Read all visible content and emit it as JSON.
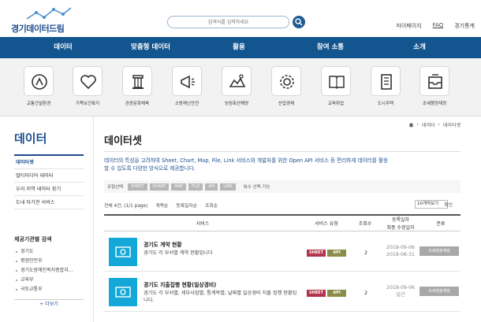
{
  "header": {
    "logo_text": "경기데이터드림",
    "search_placeholder": "검색어를 입력하세요",
    "top_links": [
      "마이페이지",
      "FAQ",
      "경기통계"
    ]
  },
  "nav": [
    "데이터",
    "맞춤형 데이터",
    "활용",
    "참여 소통",
    "소개"
  ],
  "categories": [
    {
      "label": "교통건설환경",
      "icon": "road-sign-icon"
    },
    {
      "label": "가족보건복지",
      "icon": "heart-icon"
    },
    {
      "label": "관광문화체육",
      "icon": "pillar-icon"
    },
    {
      "label": "소방재난안전",
      "icon": "megaphone-icon"
    },
    {
      "label": "농림축산해양",
      "icon": "farm-icon"
    },
    {
      "label": "산업경제",
      "icon": "gear-icon"
    },
    {
      "label": "교육취업",
      "icon": "book-icon"
    },
    {
      "label": "도시주택",
      "icon": "building-icon"
    },
    {
      "label": "조세행정재정",
      "icon": "inbox-icon"
    }
  ],
  "sidebar": {
    "title": "데이터",
    "menu": [
      "데이터셋",
      "멀티미디어 데이터",
      "우리 지역 데이터 찾기",
      "도내 타기관 서비스"
    ],
    "org_title": "제공기관별 검색",
    "orgs": [
      "경기도",
      "평정안전부",
      "경기도장애인복지종합지...",
      "교육부",
      "국토교통부"
    ],
    "more_label": "+ 더보기"
  },
  "breadcrumb": [
    "데이터",
    "데이터셋"
  ],
  "main": {
    "title": "데이터셋",
    "description": "데이터의 특성을 고려하여 Sheet, Chart, Map, File, Link 서비스와 개발자를 위한 Open API 서비스 등 편리하게 데이터를 활용할 수 있도록 다양한 방식으로 제공합니다.",
    "filter_label": "유형선택",
    "filter_tags": [
      "SHEET",
      "CHART",
      "MAP",
      "FILE",
      "API",
      "LINK"
    ],
    "filter_note": "복수 선택 가능",
    "result_count": "전체 4건, (1/1 page)",
    "sort_options": [
      "게목순",
      "등록일자순",
      "조회순"
    ],
    "page_size": "10개씩보기",
    "confirm_label": "확인",
    "columns": {
      "service": "서비스",
      "type": "서비스 유형",
      "views": "조회수",
      "dates": "등록일자",
      "dates2": "최종 수정일자",
      "category": "분류"
    },
    "rows": [
      {
        "title": "경기도 계약 현황",
        "desc": "경기도 각 부서별 계약 현황입니다",
        "badges": [
          "SHEET",
          "API"
        ],
        "views": "2",
        "reg_date": "2018-09-06",
        "mod_date": "2018-08-31",
        "category": "조세행정재정"
      },
      {
        "title": "경기도 지출집행 현황(일상경비)",
        "desc": "경기도 각 부서별, 세부사업별, 통계목별, 날짜별 일상경비 지출 집행 현황입니다.",
        "badges": [
          "SHEET",
          "API"
        ],
        "views": "2",
        "reg_date": "2018-09-06",
        "mod_date": "일간",
        "category": "조세행정재정"
      }
    ]
  },
  "colors": {
    "primary": "#12558f",
    "thumb": "#13a8d8",
    "sheet": "#b3324c",
    "api": "#8c8c4a"
  }
}
